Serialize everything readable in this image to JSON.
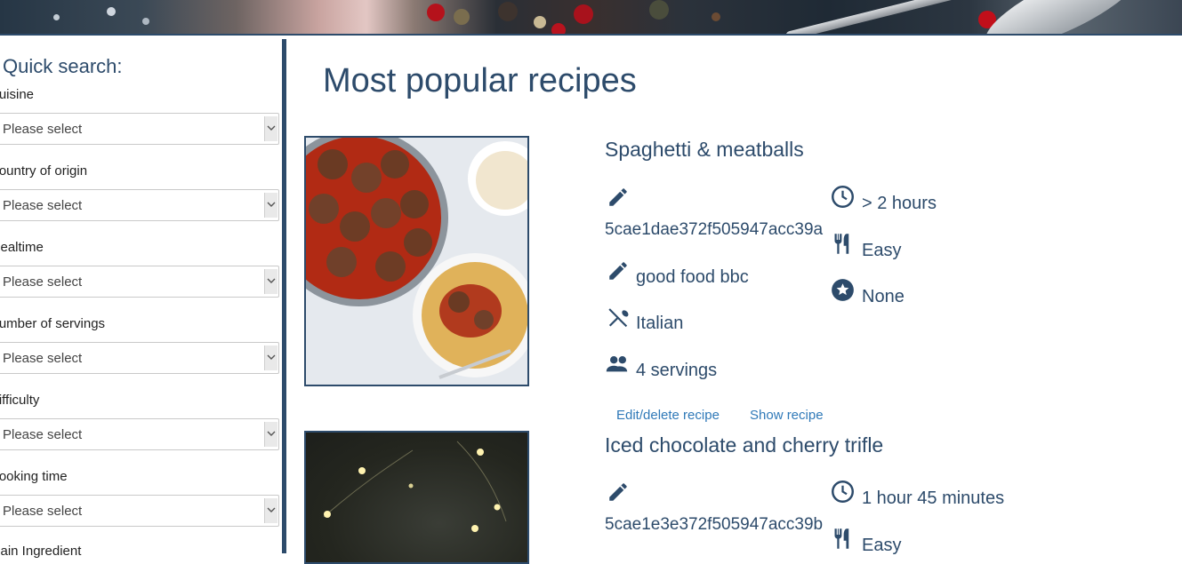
{
  "sidebar": {
    "title": "Quick search:",
    "filters": [
      {
        "label": "Cuisine",
        "value": "Please select"
      },
      {
        "label": "Country of origin",
        "value": "Please select"
      },
      {
        "label": "Mealtime",
        "value": "Please select"
      },
      {
        "label": "Number of servings",
        "value": "Please select"
      },
      {
        "label": "Difficulty",
        "value": "Please select"
      },
      {
        "label": "Cooking time",
        "value": "Please select"
      },
      {
        "label": "Main Ingredient",
        "value": ""
      }
    ]
  },
  "main": {
    "title": "Most popular recipes",
    "recipes": [
      {
        "name": "Spaghetti & meatballs",
        "id": "5cae1dae372f505947acc39a",
        "author": "good food bbc",
        "cuisine": "Italian",
        "servings": "4 servings",
        "time": "> 2 hours",
        "difficulty": "Easy",
        "rating": "None",
        "edit_label": "Edit/delete recipe",
        "show_label": "Show recipe"
      },
      {
        "name": "Iced chocolate and cherry trifle",
        "id": "5cae1e3e372f505947acc39b",
        "time": "1 hour 45 minutes",
        "difficulty": "Easy"
      }
    ]
  },
  "icons": {
    "author": "pencil-icon",
    "cuisine": "utensils-cross-icon",
    "servings": "people-icon",
    "time": "clock-icon",
    "difficulty": "fork-knife-icon",
    "rating": "star-icon"
  },
  "colors": {
    "accent": "#2d4b6b",
    "link": "#2f79b8"
  }
}
